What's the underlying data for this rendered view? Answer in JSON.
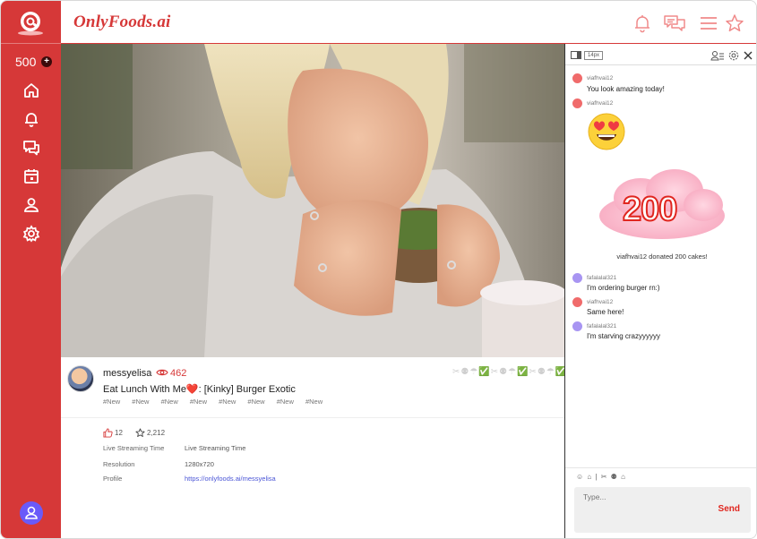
{
  "app": {
    "brand": "OnlyFoods.ai",
    "accent": "#d63838"
  },
  "sidebar": {
    "coins": "500",
    "coins_add": "+",
    "items": [
      {
        "icon": "home-icon"
      },
      {
        "icon": "bell-icon"
      },
      {
        "icon": "chat-icon"
      },
      {
        "icon": "calendar-icon"
      },
      {
        "icon": "user-icon"
      },
      {
        "icon": "gear-icon"
      }
    ],
    "profile_icon": "avatar-icon"
  },
  "header": {
    "icons": [
      "bell-icon",
      "messages-icon",
      "menu-icon",
      "star-icon"
    ]
  },
  "stream": {
    "streamer": "messyelisa",
    "views": "462",
    "title": "Eat Lunch With Me❤️: [Kinky] Burger Exotic",
    "tags": [
      "#New",
      "#New",
      "#New",
      "#New",
      "#New",
      "#New",
      "#New",
      "#New"
    ],
    "reactions": "✂⚉☂✅✂⚉☂✅✂⚉☂✅",
    "likes": "12",
    "favorites": "2,212",
    "meta": [
      {
        "label": "Live Streaming Time",
        "value": "Live Streaming Time",
        "link": false
      },
      {
        "label": "Resolution",
        "value": "1280x720",
        "link": false
      },
      {
        "label": "Profile",
        "value": "https://onlyfoods.ai/messyelisa",
        "link": true
      }
    ]
  },
  "chat": {
    "font_size": "14px",
    "messages": [
      {
        "user": "viafhvai12",
        "text": "You look amazing today!",
        "color": "#f06b6b"
      },
      {
        "user": "viafhvai12",
        "text": "",
        "color": "#f06b6b",
        "emoji": "heart-eyes-emoji"
      },
      {
        "user": "fafalalal321",
        "text": "I'm ordering burger rn:)",
        "color": "#a895f2"
      },
      {
        "user": "viafhvai12",
        "text": "Same here!",
        "color": "#f06b6b"
      },
      {
        "user": "fafalalal321",
        "text": "I'm starving crazyyyyyy",
        "color": "#a895f2"
      }
    ],
    "donation": {
      "amount": "200",
      "text": "viafhvai12 donated 200 cakes!"
    },
    "tools": "☺ ⌂  |  ✂ ⚉ ⌂",
    "input_placeholder": "Type...",
    "send_label": "Send"
  }
}
